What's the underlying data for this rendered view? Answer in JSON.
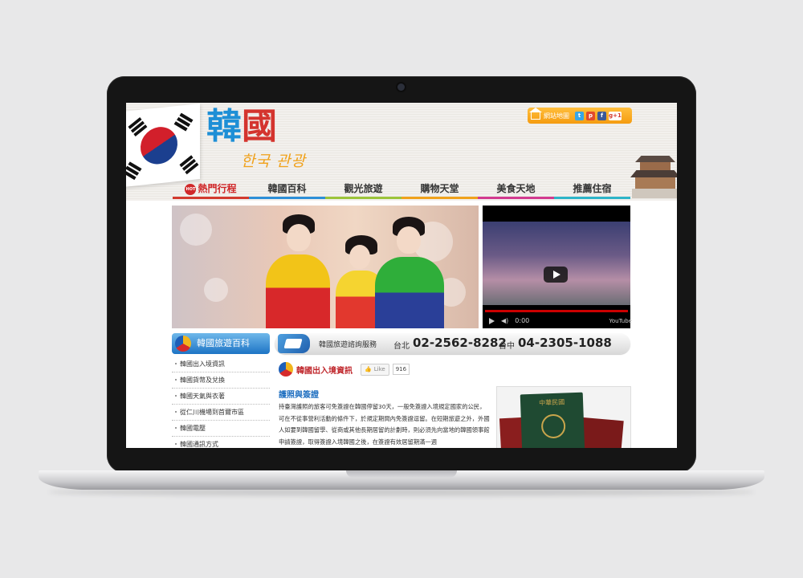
{
  "header": {
    "logo_cn_1": "韓",
    "logo_cn_2": "國",
    "logo_kr": "한국 관광",
    "sitemap_label": "網站地圖",
    "social": [
      "t",
      "p",
      "f",
      "g+1"
    ]
  },
  "nav": {
    "hot_badge": "HOT",
    "items": [
      "熱門行程",
      "韓國百科",
      "觀光旅遊",
      "購物天堂",
      "美食天地",
      "推薦住宿"
    ],
    "underline_colors": [
      "#d23a2f",
      "#2d8fd8",
      "#9cc43a",
      "#f0a21c",
      "#d23a8f",
      "#2db5c8"
    ]
  },
  "video": {
    "time": "0:00",
    "brand": "YouTube"
  },
  "sidebar": {
    "title": "韓國旅遊百科",
    "items": [
      "韓國出入境資訊",
      "韓國貨幣及兌換",
      "韓國天氣與衣著",
      "從仁川機場到首爾市區",
      "韓國電壓",
      "韓國通訊方式"
    ]
  },
  "service_bar": {
    "label": "韓國旅遊諮詢服務",
    "city1": "台北",
    "phone1": "02-2562-8282",
    "city2": "台中",
    "phone2": "04-2305-1088"
  },
  "main": {
    "section_title": "韓國出入境資訊",
    "like_label": "Like",
    "like_count": "916",
    "subtitle": "護照與簽證",
    "article": "持臺灣護照的旅客可免簽證在韓國停留30天，一般免簽證入境規定國家的公民，可在不從事營利活動的條件下，於規定期間內免簽證逗留。在短期旅遊之外，外國人如要到韓國留學、從商或其他長期居留的計劃時，則必須先向當地的韓國領事館申請簽證，取得簽證入境韓國之後，在簽證有效居留期滿一週",
    "passport_caption": "中華民國"
  },
  "colors": {
    "accent_orange": "#f59c10",
    "accent_blue": "#1d74c5",
    "accent_red": "#c0282d"
  }
}
